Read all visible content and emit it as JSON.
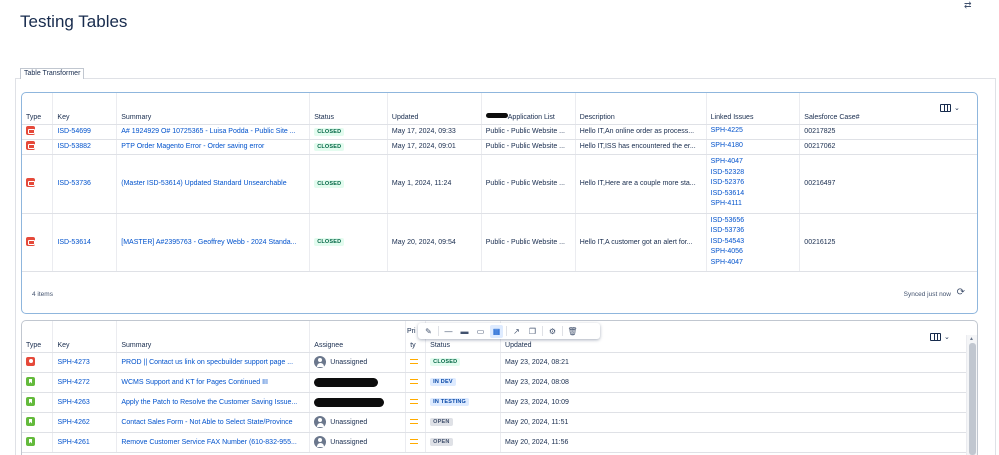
{
  "page": {
    "title": "Testing Tables"
  },
  "macro": {
    "tab_label": "Table Transformer"
  },
  "table1": {
    "headers": [
      "Type",
      "Key",
      "Summary",
      "Status",
      "Updated",
      "Application List",
      "Description",
      "Linked Issues",
      "Salesforce Case#"
    ],
    "rows": [
      {
        "key": "ISD-54699",
        "summary": "A# 1924929 O# 10725365 - Luisa Podda - Public Site ...",
        "status": "CLOSED",
        "updated": "May 17, 2024, 09:33",
        "app": "Public - Public Website ...",
        "desc": "Hello IT,An online order as process...",
        "linked": [
          "SPH-4225"
        ],
        "case": "00217825"
      },
      {
        "key": "ISD-53882",
        "summary": "PTP Order Magento Error - Order saving error",
        "status": "CLOSED",
        "updated": "May 17, 2024, 09:01",
        "app": "Public - Public Website ...",
        "desc": "Hello IT,ISS has encountered the er...",
        "linked": [
          "SPH-4180"
        ],
        "case": "00217062"
      },
      {
        "key": "ISD-53736",
        "summary": "(Master ISD-53614) Updated Standard Unsearchable",
        "status": "CLOSED",
        "updated": "May 1, 2024, 11:24",
        "app": "Public - Public Website ...",
        "desc": "Hello IT,Here are a couple more sta...",
        "linked": [
          "SPH-4047",
          "ISD-52328",
          "ISD-52376",
          "ISD-53614",
          "SPH-4111"
        ],
        "case": "00216497"
      },
      {
        "key": "ISD-53614",
        "summary": "[MASTER] A#2395763 - Geoffrey Webb - 2024 Standa...",
        "status": "CLOSED",
        "updated": "May 20, 2024, 09:54",
        "app": "Public - Public Website ...",
        "desc": "Hello IT,A customer got an alert for...",
        "linked": [
          "ISD-53656",
          "ISD-53736",
          "ISD-54543",
          "SPH-4056",
          "SPH-4047"
        ],
        "case": "00216125"
      }
    ],
    "footer": {
      "count": "4 items",
      "synced": "Synced just now"
    }
  },
  "table2": {
    "headers": [
      "Type",
      "Key",
      "Summary",
      "Assignee",
      "Pri ty",
      "Status",
      "Updated"
    ],
    "priority_header_top": "Pri",
    "priority_header_bottom": "ty",
    "rows": [
      {
        "type": "bug",
        "key": "SPH-4273",
        "summary": "PROD || Contact us link on specbuilder support page ...",
        "assignee": "Unassigned",
        "status": "CLOSED",
        "status_style": "green",
        "updated": "May 23, 2024, 08:21"
      },
      {
        "type": "story",
        "key": "SPH-4272",
        "summary": "WCMS Support and KT for Pages Continued III",
        "assignee": "",
        "status": "IN DEV",
        "status_style": "blue",
        "updated": "May 23, 2024, 08:08"
      },
      {
        "type": "story",
        "key": "SPH-4263",
        "summary": "Apply the Patch to Resolve the Customer Saving Issue...",
        "assignee": "",
        "status": "IN TESTING",
        "status_style": "blue",
        "updated": "May 23, 2024, 10:09"
      },
      {
        "type": "story",
        "key": "SPH-4262",
        "summary": "Contact Sales Form - Not Able to Select State/Province",
        "assignee": "Unassigned",
        "status": "OPEN",
        "status_style": "grey",
        "updated": "May 20, 2024, 11:51"
      },
      {
        "type": "story",
        "key": "SPH-4261",
        "summary": "Remove Customer Service FAX Number (610-832-955...",
        "assignee": "Unassigned",
        "status": "OPEN",
        "status_style": "grey",
        "updated": "May 20, 2024, 11:56"
      }
    ]
  },
  "icons": {
    "column_picker": "columns-icon",
    "sync": "refresh-icon",
    "toolbar": [
      "edit-icon",
      "divider-line-icon",
      "insert-row-icon",
      "insert-column-icon",
      "table-layout-icon",
      "open-external-icon",
      "copy-icon",
      "settings-icon",
      "delete-icon"
    ]
  },
  "colors": {
    "link": "#0052cc",
    "bug": "#e5493a",
    "story": "#63ba3c",
    "priority_medium": "#ffab00"
  }
}
